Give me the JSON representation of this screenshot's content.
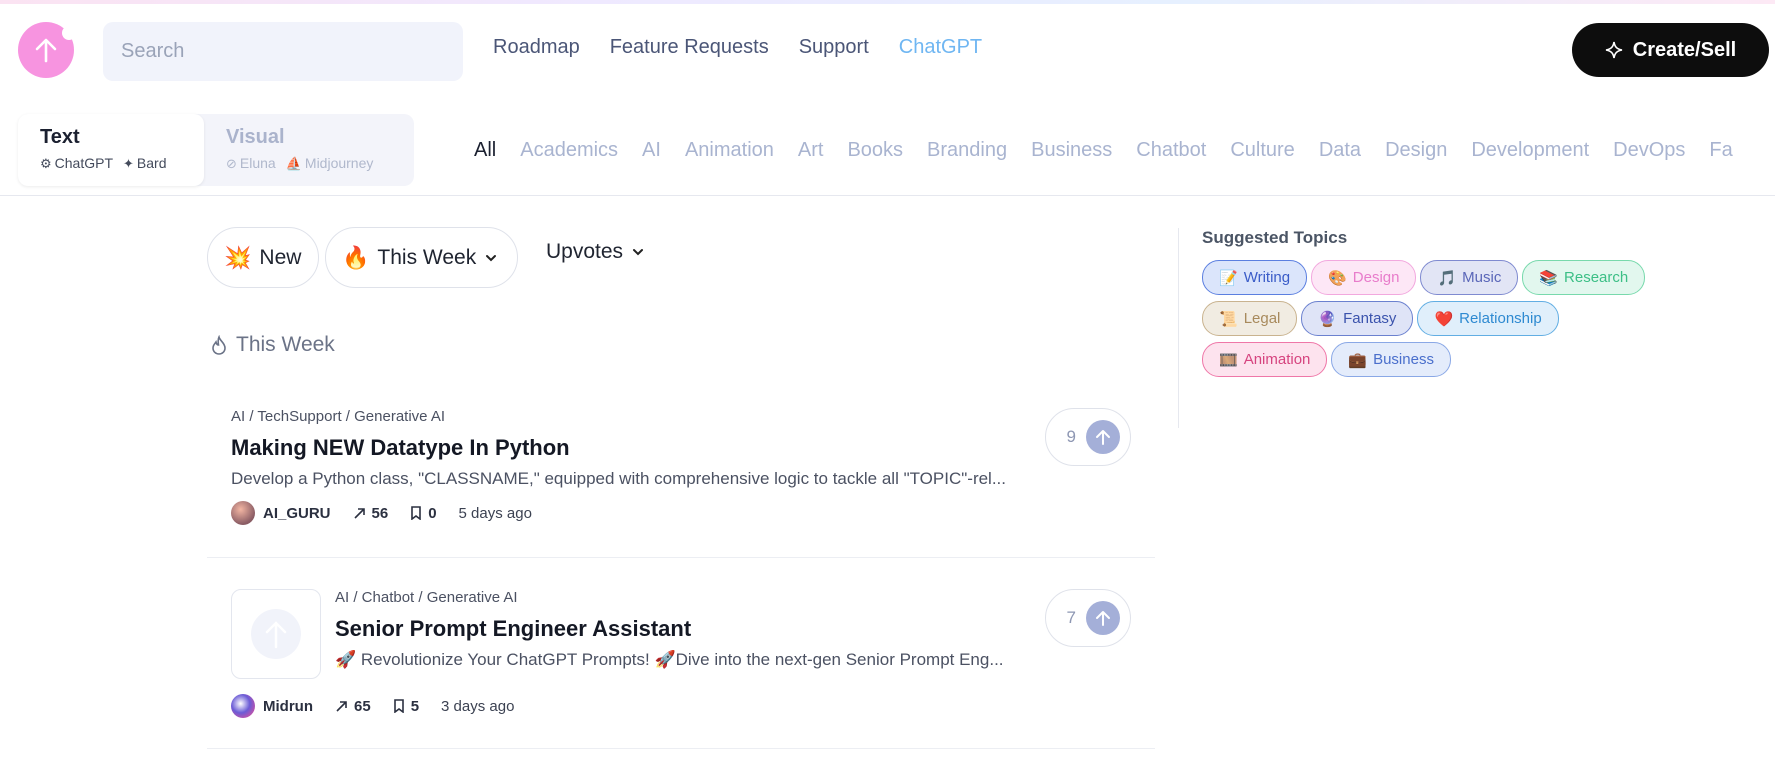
{
  "header": {
    "search_placeholder": "Search",
    "nav": [
      "Roadmap",
      "Feature Requests",
      "Support",
      "ChatGPT"
    ],
    "create_label": "Create/Sell"
  },
  "model_tabs": {
    "text": {
      "title": "Text",
      "models": [
        "ChatGPT",
        "Bard"
      ]
    },
    "visual": {
      "title": "Visual",
      "models": [
        "Eluna",
        "Midjourney"
      ]
    }
  },
  "categories": [
    "All",
    "Academics",
    "AI",
    "Animation",
    "Art",
    "Books",
    "Branding",
    "Business",
    "Chatbot",
    "Culture",
    "Data",
    "Design",
    "Development",
    "DevOps",
    "Fa"
  ],
  "filters": {
    "new_label": "New",
    "week_label": "This Week",
    "sort_label": "Upvotes"
  },
  "section_title": "This Week",
  "prompts": [
    {
      "breadcrumb": "AI / TechSupport / Generative AI",
      "title": "Making NEW Datatype In Python",
      "description": "Develop a Python class, \"CLASSNAME,\" equipped with comprehensive logic to tackle all \"TOPIC\"-rel...",
      "author": "AI_GURU",
      "uses": "56",
      "saves": "0",
      "time": "5 days ago",
      "votes": "9"
    },
    {
      "breadcrumb": "AI / Chatbot / Generative AI",
      "title": "Senior Prompt Engineer Assistant",
      "description": "🚀 Revolutionize Your ChatGPT Prompts! 🚀Dive into the next-gen Senior Prompt Eng...",
      "author": "Midrun",
      "uses": "65",
      "saves": "5",
      "time": "3 days ago",
      "votes": "7"
    }
  ],
  "suggested": {
    "title": "Suggested Topics",
    "topics": [
      {
        "label": "Writing",
        "emoji": "📝",
        "bg": "#dbe5fb",
        "border": "#5b7fe0",
        "color": "#3a5cc8"
      },
      {
        "label": "Design",
        "emoji": "🎨",
        "bg": "#fde7f6",
        "border": "#f2a8de",
        "color": "#e87ccb"
      },
      {
        "label": "Music",
        "emoji": "🎵",
        "bg": "#e2e5f5",
        "border": "#7f8ad0",
        "color": "#5a66b8"
      },
      {
        "label": "Research",
        "emoji": "📚",
        "bg": "#e2f7ee",
        "border": "#78d9ac",
        "color": "#3cbf86"
      },
      {
        "label": "Legal",
        "emoji": "📜",
        "bg": "#f1ece2",
        "border": "#c9b38f",
        "color": "#a88a5c"
      },
      {
        "label": "Fantasy",
        "emoji": "🔮",
        "bg": "#dfe4f7",
        "border": "#6b81cf",
        "color": "#3b53ad"
      },
      {
        "label": "Relationship",
        "emoji": "❤️",
        "bg": "#e0effb",
        "border": "#62aee3",
        "color": "#2e8ad1"
      },
      {
        "label": "Animation",
        "emoji": "🎞️",
        "bg": "#fde3ee",
        "border": "#ef77a8",
        "color": "#d6447f"
      },
      {
        "label": "Business",
        "emoji": "💼",
        "bg": "#e4ecfb",
        "border": "#8aa8e6",
        "color": "#4a6fcc"
      }
    ]
  }
}
